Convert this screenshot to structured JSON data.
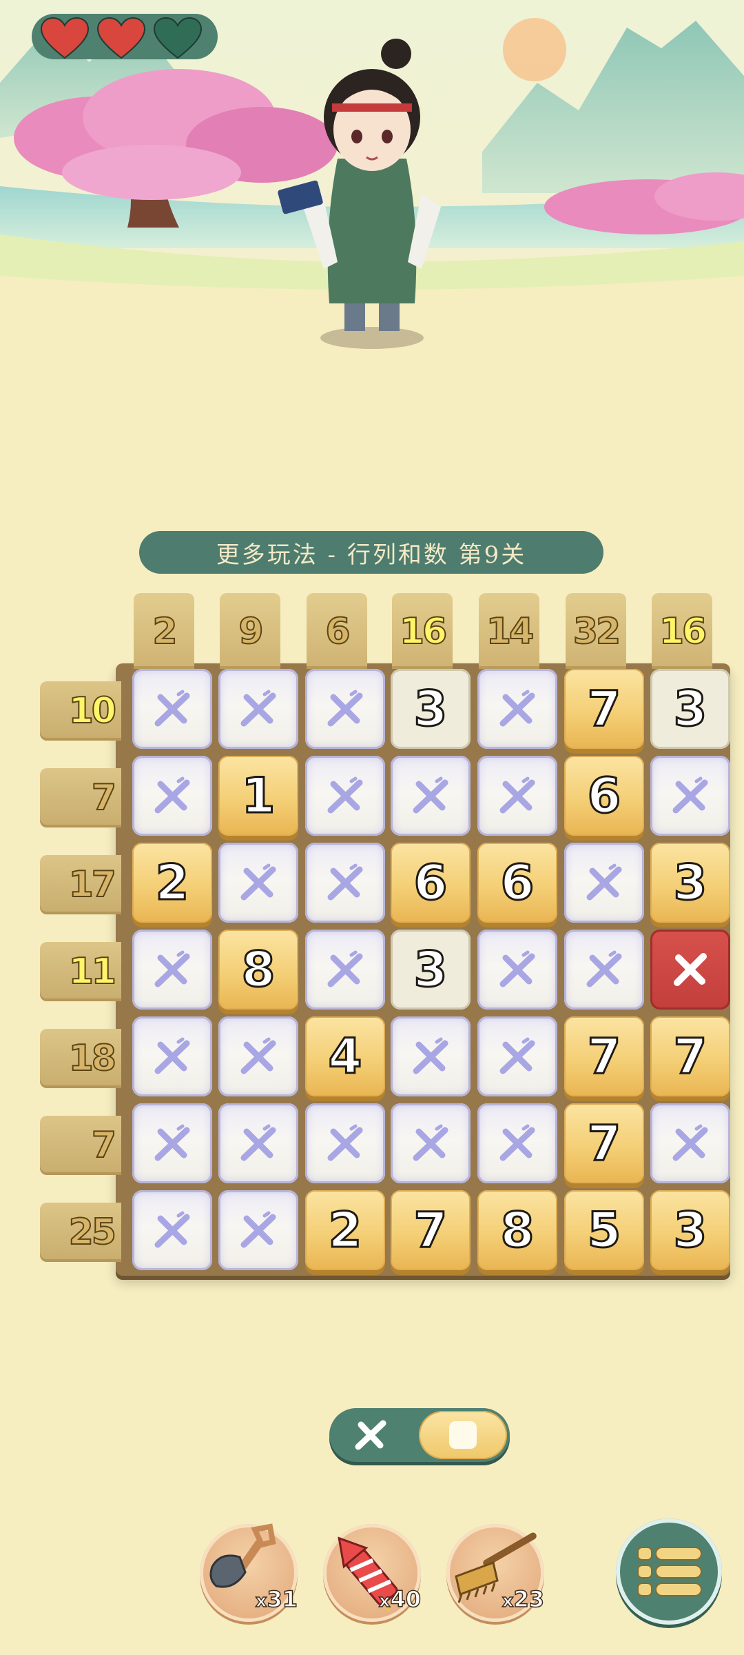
{
  "hud": {
    "lives": [
      {
        "state": "full",
        "icon": "heart-full-icon",
        "color": "#d8463e"
      },
      {
        "state": "full",
        "icon": "heart-full-icon",
        "color": "#d8463e"
      },
      {
        "state": "empty",
        "icon": "heart-empty-icon",
        "color": "#2f6d57"
      }
    ]
  },
  "level": {
    "title": "更多玩法 - 行列和数 第9关"
  },
  "board": {
    "col_clues": [
      {
        "value": "2",
        "style": "tan"
      },
      {
        "value": "9",
        "style": "tan"
      },
      {
        "value": "6",
        "style": "tan"
      },
      {
        "value": "16",
        "style": "yellow"
      },
      {
        "value": "14",
        "style": "tan"
      },
      {
        "value": "32",
        "style": "tan"
      },
      {
        "value": "16",
        "style": "yellow"
      }
    ],
    "row_clues": [
      {
        "value": "10",
        "style": "yellow"
      },
      {
        "value": "7",
        "style": "tan"
      },
      {
        "value": "17",
        "style": "tan"
      },
      {
        "value": "11",
        "style": "yellow"
      },
      {
        "value": "18",
        "style": "tan"
      },
      {
        "value": "7",
        "style": "tan"
      },
      {
        "value": "25",
        "style": "tan"
      }
    ],
    "cells": [
      [
        {
          "t": "x"
        },
        {
          "t": "x"
        },
        {
          "t": "x"
        },
        {
          "t": "num",
          "v": "3",
          "s": "cream"
        },
        {
          "t": "x"
        },
        {
          "t": "num",
          "v": "7",
          "s": "gold"
        },
        {
          "t": "num",
          "v": "3",
          "s": "cream"
        }
      ],
      [
        {
          "t": "x"
        },
        {
          "t": "num",
          "v": "1",
          "s": "gold"
        },
        {
          "t": "x"
        },
        {
          "t": "x"
        },
        {
          "t": "x"
        },
        {
          "t": "num",
          "v": "6",
          "s": "gold"
        },
        {
          "t": "x"
        }
      ],
      [
        {
          "t": "num",
          "v": "2",
          "s": "gold"
        },
        {
          "t": "x"
        },
        {
          "t": "x"
        },
        {
          "t": "num",
          "v": "6",
          "s": "gold"
        },
        {
          "t": "num",
          "v": "6",
          "s": "gold"
        },
        {
          "t": "x"
        },
        {
          "t": "num",
          "v": "3",
          "s": "gold"
        }
      ],
      [
        {
          "t": "x"
        },
        {
          "t": "num",
          "v": "8",
          "s": "gold"
        },
        {
          "t": "x"
        },
        {
          "t": "num",
          "v": "3",
          "s": "cream"
        },
        {
          "t": "x"
        },
        {
          "t": "x"
        },
        {
          "t": "err"
        }
      ],
      [
        {
          "t": "x"
        },
        {
          "t": "x"
        },
        {
          "t": "num",
          "v": "4",
          "s": "gold"
        },
        {
          "t": "x"
        },
        {
          "t": "x"
        },
        {
          "t": "num",
          "v": "7",
          "s": "gold"
        },
        {
          "t": "num",
          "v": "7",
          "s": "gold"
        }
      ],
      [
        {
          "t": "x"
        },
        {
          "t": "x"
        },
        {
          "t": "x"
        },
        {
          "t": "x"
        },
        {
          "t": "x"
        },
        {
          "t": "num",
          "v": "7",
          "s": "gold"
        },
        {
          "t": "x"
        }
      ],
      [
        {
          "t": "x"
        },
        {
          "t": "x"
        },
        {
          "t": "num",
          "v": "2",
          "s": "gold"
        },
        {
          "t": "num",
          "v": "7",
          "s": "gold"
        },
        {
          "t": "num",
          "v": "8",
          "s": "gold"
        },
        {
          "t": "num",
          "v": "5",
          "s": "gold"
        },
        {
          "t": "num",
          "v": "3",
          "s": "gold"
        }
      ]
    ]
  },
  "mode_toggle": {
    "options": [
      "mark-x",
      "fill"
    ],
    "selected": "fill"
  },
  "tools": [
    {
      "name": "shovel",
      "icon": "shovel-icon",
      "prefix": "x",
      "count": "31"
    },
    {
      "name": "firework",
      "icon": "firework-rocket-icon",
      "prefix": "x",
      "count": "40"
    },
    {
      "name": "rake",
      "icon": "rake-icon",
      "prefix": "x",
      "count": "23"
    }
  ],
  "menu": {
    "icon": "list-menu-icon"
  },
  "colors": {
    "background": "#f6eec0",
    "accent": "#4f8170",
    "gold": "#f4cf76",
    "mark": "#a9a6e4",
    "error": "#c94543"
  }
}
